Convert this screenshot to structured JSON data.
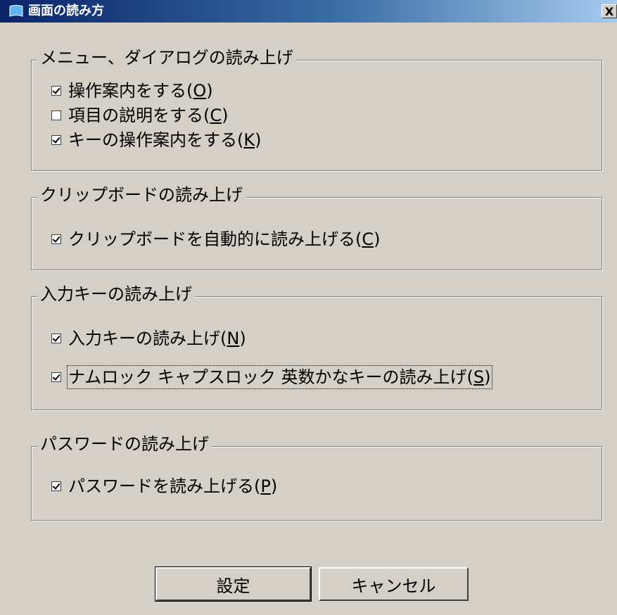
{
  "window": {
    "title": "画面の読み方",
    "close_label": "X"
  },
  "groups": [
    {
      "legend": "メニュー、ダイアログの読み上げ",
      "options": [
        {
          "label": "操作案内をする(",
          "mnemonic": "O",
          "tail": ")",
          "checked": true
        },
        {
          "label": "項目の説明をする(",
          "mnemonic": "C",
          "tail": ")",
          "checked": false
        },
        {
          "label": "キーの操作案内をする(",
          "mnemonic": "K",
          "tail": ")",
          "checked": true
        }
      ]
    },
    {
      "legend": "クリップボードの読み上げ",
      "options": [
        {
          "label": "クリップボードを自動的に読み上げる(",
          "mnemonic": "C",
          "tail": ")",
          "checked": true
        }
      ]
    },
    {
      "legend": "入力キーの読み上げ",
      "options": [
        {
          "label": "入力キーの読み上げ(",
          "mnemonic": "N",
          "tail": ")",
          "checked": true
        },
        {
          "label": "ナムロック キャプスロック 英数かなキーの読み上げ(",
          "mnemonic": "S",
          "tail": ")",
          "checked": true,
          "focused": true
        }
      ]
    },
    {
      "legend": "パスワードの読み上げ",
      "options": [
        {
          "label": "パスワードを読み上げる(",
          "mnemonic": "P",
          "tail": ")",
          "checked": true
        }
      ]
    }
  ],
  "buttons": {
    "ok": "設定",
    "cancel": "キャンセル"
  },
  "colors": {
    "face": "#d4d0c8",
    "title_start": "#0a246a",
    "title_end": "#a6caf0"
  }
}
